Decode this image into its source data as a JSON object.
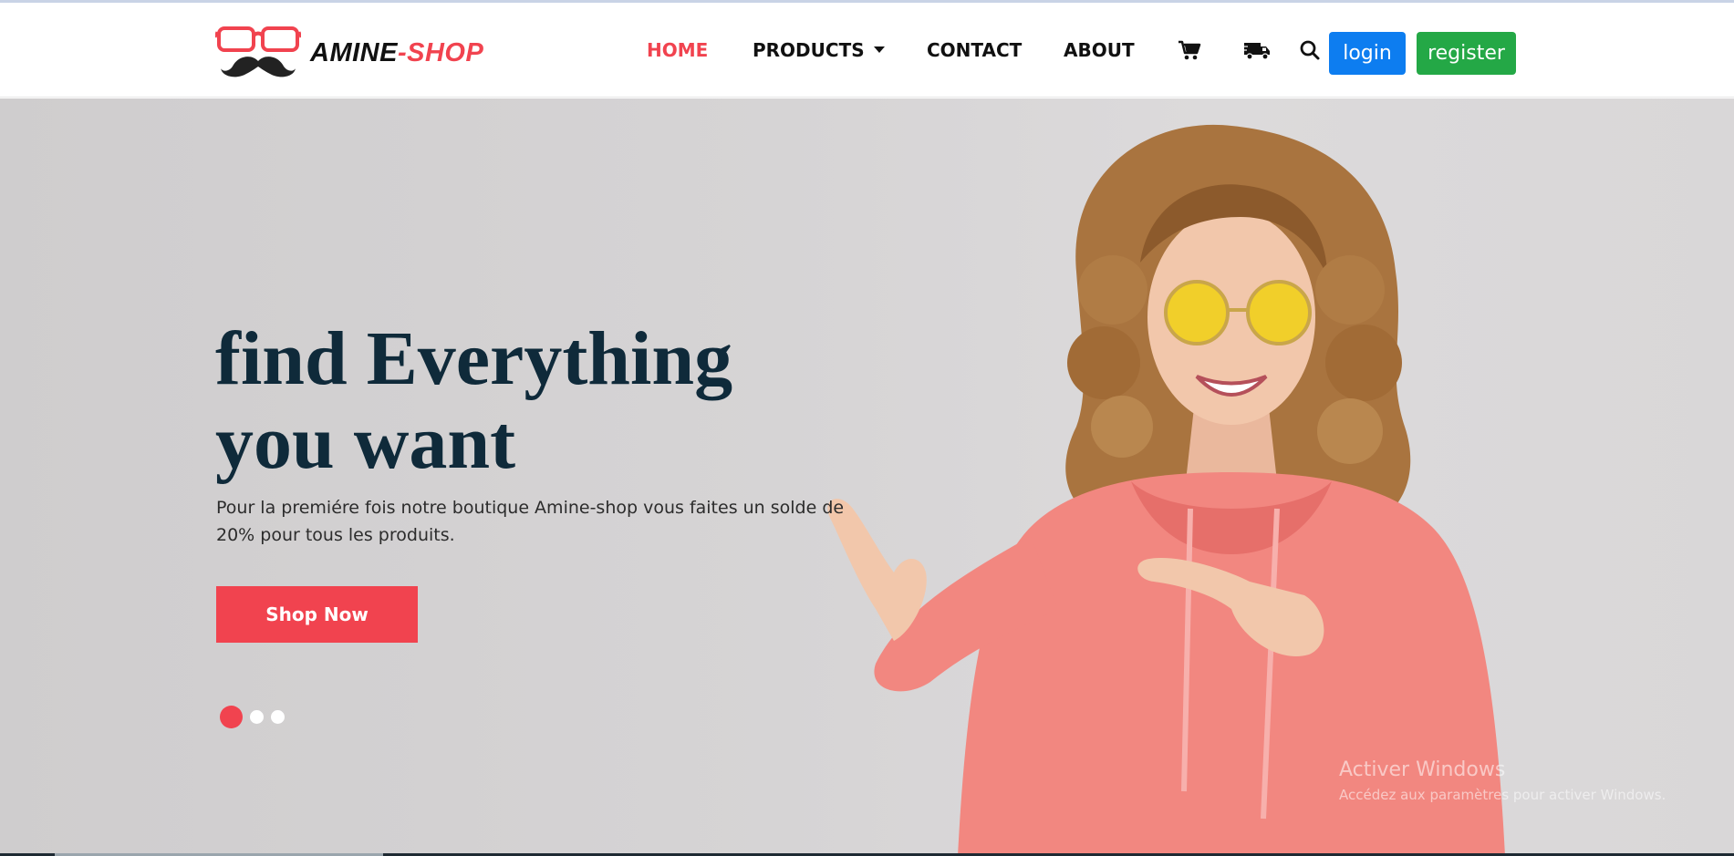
{
  "brand": {
    "name_part1": "AMINE",
    "name_part2": "-SHOP",
    "accent_color": "#f1434f"
  },
  "nav": {
    "items": [
      {
        "label": "HOME",
        "active": true
      },
      {
        "label": "PRODUCTS",
        "dropdown": true
      },
      {
        "label": "CONTACT"
      },
      {
        "label": "ABOUT"
      }
    ],
    "icons": [
      "cart-icon",
      "delivery-truck-icon",
      "search-icon"
    ],
    "login_label": "login",
    "register_label": "register",
    "login_color": "#0d7df0",
    "register_color": "#24a846"
  },
  "hero": {
    "title_line1": "find Everything",
    "title_line2": "you want",
    "description": "Pour la premiére fois notre boutique Amine-shop vous faites un solde de 20% pour tous les produits.",
    "cta_label": "Shop Now",
    "slides_count": 3,
    "active_slide": 1
  },
  "watermark": {
    "title": "Activer Windows",
    "subtitle": "Accédez aux paramètres pour activer Windows."
  }
}
